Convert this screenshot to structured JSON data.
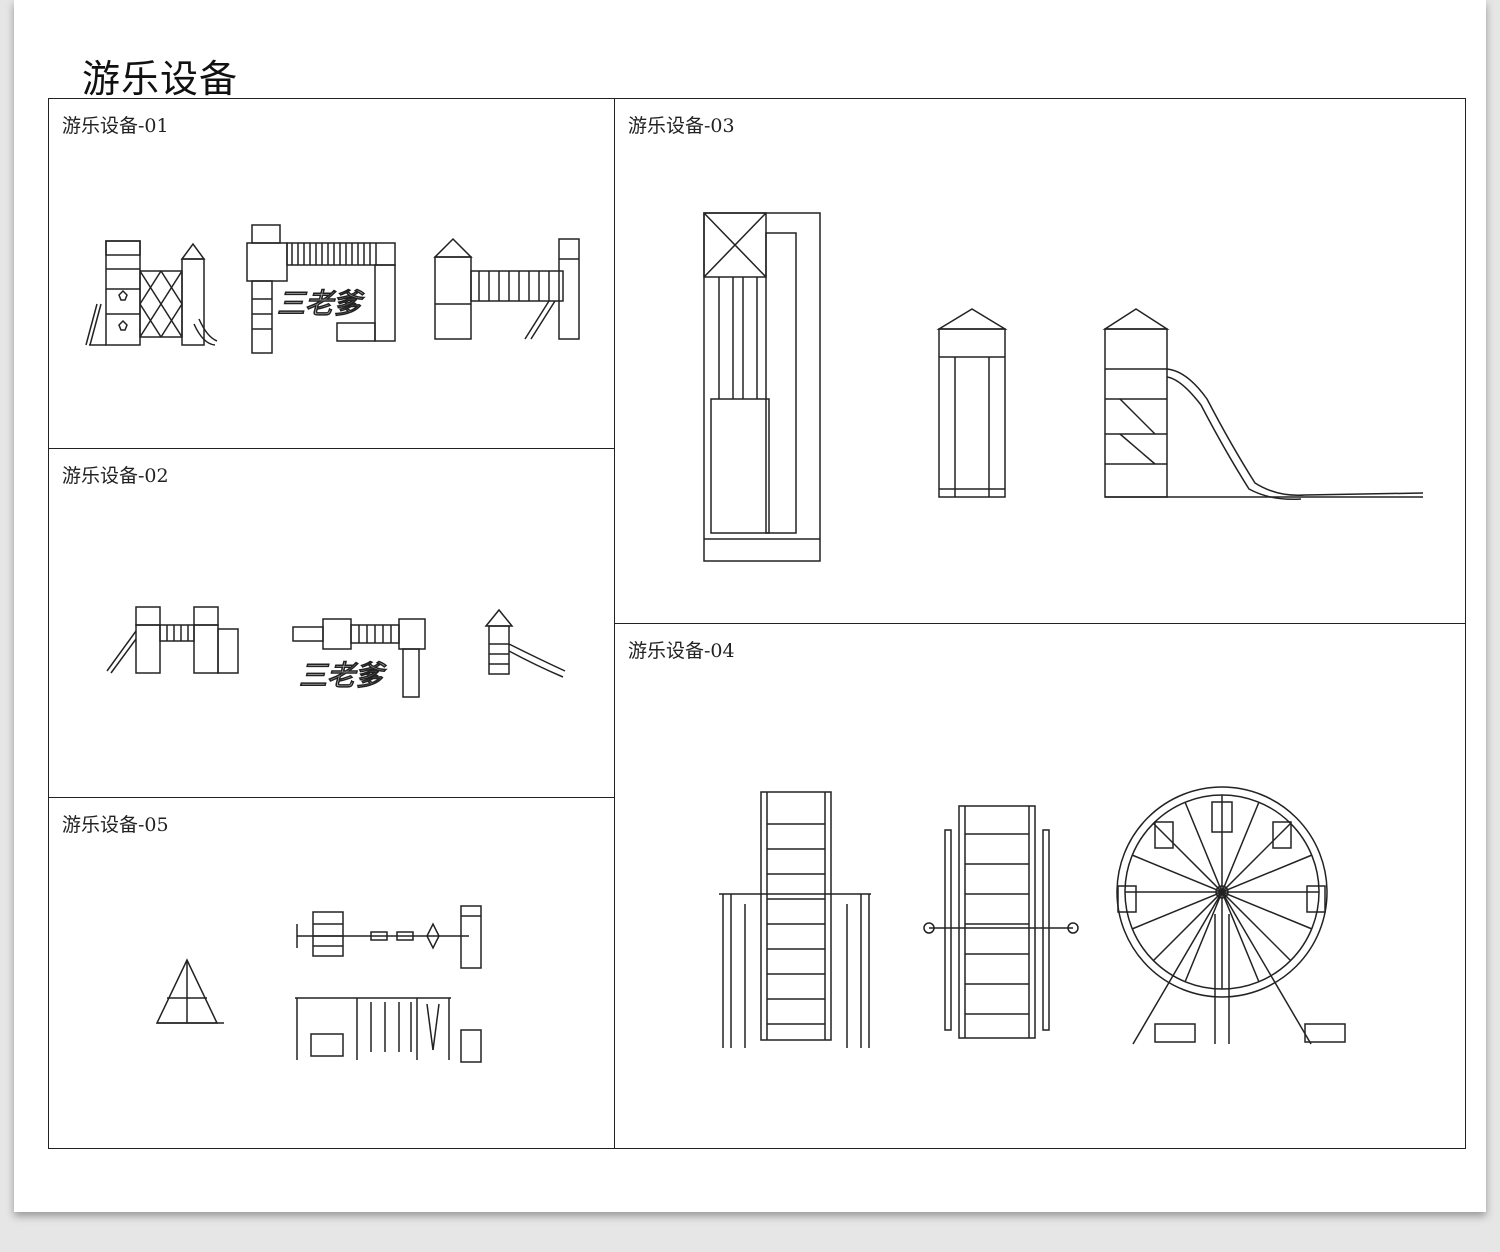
{
  "page": {
    "title": "游乐设备"
  },
  "panels": [
    {
      "id": "01",
      "label": "游乐设备-01"
    },
    {
      "id": "02",
      "label": "游乐设备-02"
    },
    {
      "id": "03",
      "label": "游乐设备-03"
    },
    {
      "id": "04",
      "label": "游乐设备-04"
    },
    {
      "id": "05",
      "label": "游乐设备-05"
    }
  ],
  "watermark": "三老爹"
}
